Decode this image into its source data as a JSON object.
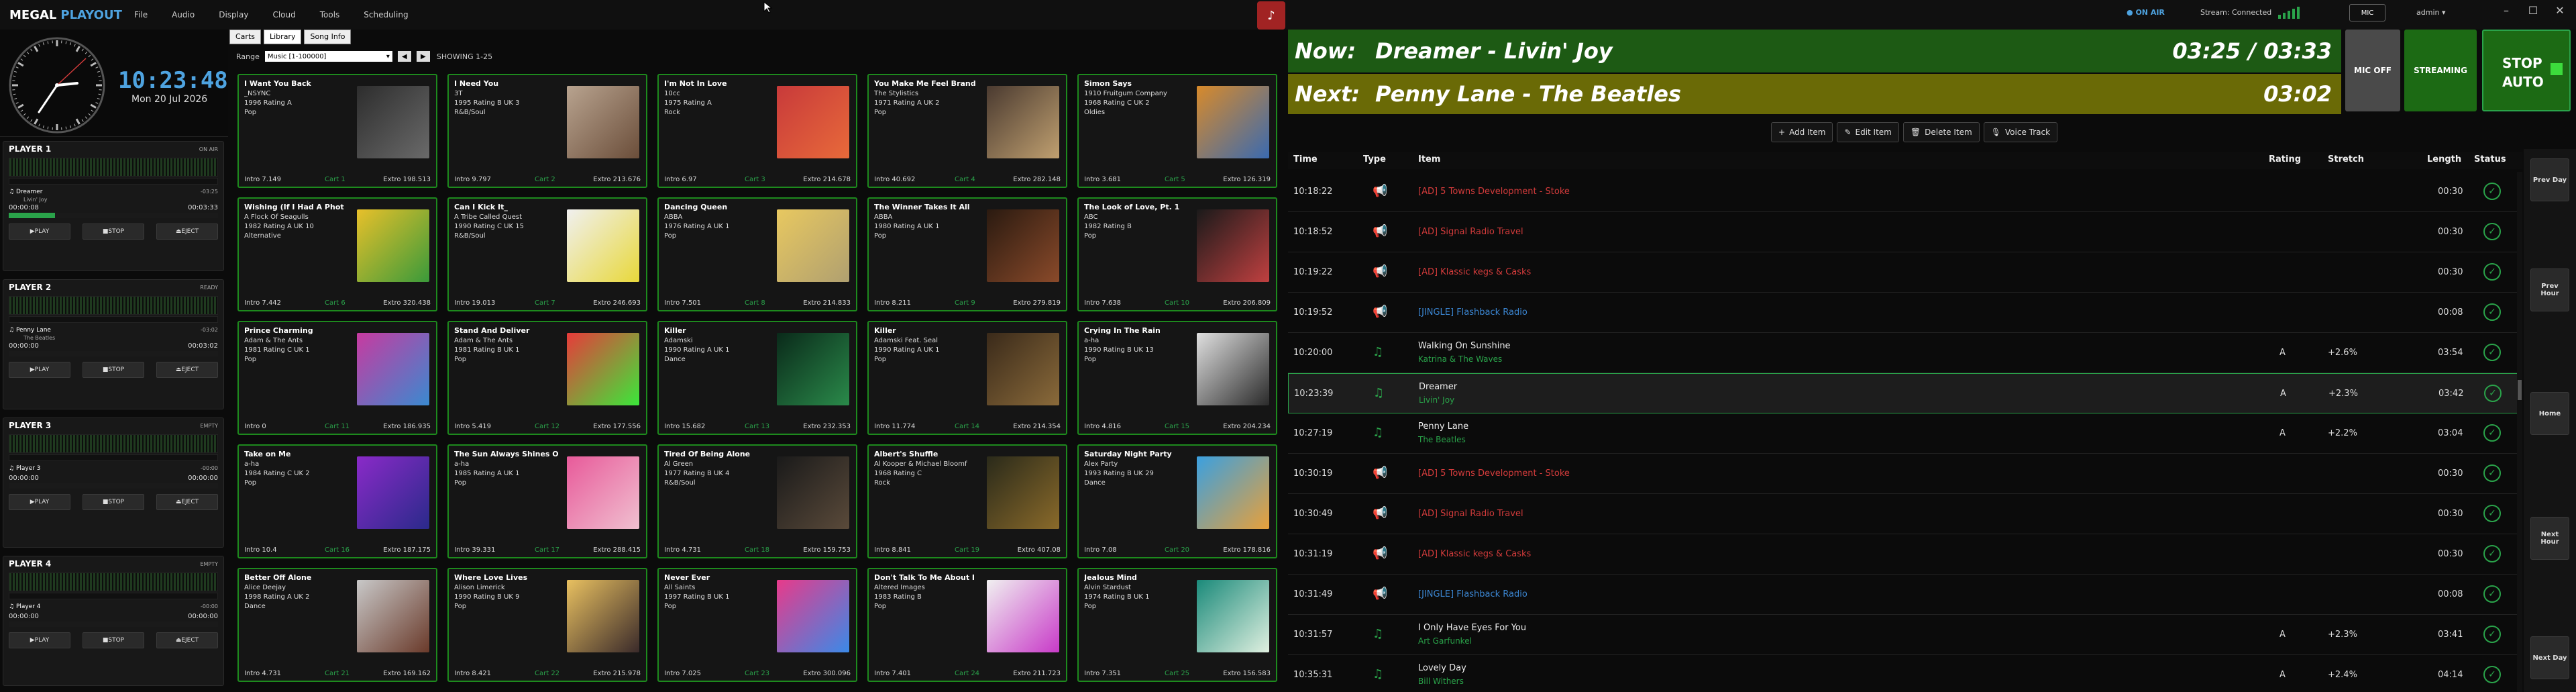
{
  "app": {
    "name1": "MEGAL",
    "name2": "PLAYOUT"
  },
  "menu": [
    "File",
    "Audio",
    "Display",
    "Cloud",
    "Tools",
    "Scheduling"
  ],
  "clock": {
    "time": "10:23:48",
    "date": "Mon 20 Jul 2026"
  },
  "players": [
    {
      "title": "PLAYER 1",
      "status": "ON AIR",
      "track": "Dreamer",
      "track_right": "-03:25",
      "artist": "Livin' Joy",
      "elapsed": "00:00:08",
      "remaining": "00:03:33",
      "progress": 0.22,
      "play": "PLAY",
      "stop": "STOP",
      "eject": "EJECT"
    },
    {
      "title": "PLAYER 2",
      "status": "READY",
      "track": "Penny Lane",
      "track_right": "-03:02",
      "artist": "The Beatles",
      "elapsed": "00:00:00",
      "remaining": "00:03:02",
      "progress": 0.0,
      "play": "PLAY",
      "stop": "STOP",
      "eject": "EJECT"
    },
    {
      "title": "PLAYER 3",
      "status": "EMPTY",
      "track": "Player 3",
      "track_right": "-00:00",
      "artist": "",
      "elapsed": "00:00:00",
      "remaining": "00:00:00",
      "progress": 0.0,
      "play": "PLAY",
      "stop": "STOP",
      "eject": "EJECT"
    },
    {
      "title": "PLAYER 4",
      "status": "EMPTY",
      "track": "Player 4",
      "track_right": "-00:00",
      "artist": "",
      "elapsed": "00:00:00",
      "remaining": "00:00:00",
      "progress": 0.0,
      "play": "PLAY",
      "stop": "STOP",
      "eject": "EJECT"
    }
  ],
  "library": {
    "tabs": [
      "Carts",
      "Library",
      "Song Info"
    ],
    "range_label": "Range",
    "range_value": "Music [1-100000]",
    "showing": "SHOWING 1-25",
    "cards": [
      {
        "title": "I Want You Back",
        "artist": "_NSYNC",
        "yearline": "1996  Rating A",
        "genre": "Pop",
        "intro": "Intro 7.149",
        "cart": "Cart 1",
        "extro": "Extro 198.513",
        "colors": [
          "#2d2d2d",
          "#6a6a6a"
        ]
      },
      {
        "title": "I Need You",
        "artist": "3T",
        "yearline": "1995  Rating B  UK 3",
        "genre": "R&B/Soul",
        "intro": "Intro 9.797",
        "cart": "Cart 2",
        "extro": "Extro 213.676",
        "colors": [
          "#b8a38f",
          "#6b4e3a"
        ]
      },
      {
        "title": "I'm Not In Love",
        "artist": "10cc",
        "yearline": "1975  Rating A",
        "genre": "Rock",
        "intro": "Intro 6.97",
        "cart": "Cart 3",
        "extro": "Extro 214.678",
        "colors": [
          "#c83a3a",
          "#e86a3a"
        ]
      },
      {
        "title": "You Make Me Feel Brand",
        "artist": "The Stylistics",
        "yearline": "1971  Rating A  UK 2",
        "genre": "Pop",
        "intro": "Intro 40.692",
        "cart": "Cart 4",
        "extro": "Extro 282.148",
        "colors": [
          "#4a3a30",
          "#c0a070"
        ]
      },
      {
        "title": "Simon Says",
        "artist": "1910 Fruitgum Company",
        "yearline": "1968  Rating C  UK 2",
        "genre": "Oldies",
        "intro": "Intro 3.681",
        "cart": "Cart 5",
        "extro": "Extro 126.319",
        "colors": [
          "#d88a2a",
          "#3a6ab0"
        ]
      },
      {
        "title": "Wishing (If I Had A Phot",
        "artist": "A Flock Of Seagulls",
        "yearline": "1982  Rating A  UK 10",
        "genre": "Alternative",
        "intro": "Intro 7.442",
        "cart": "Cart 6",
        "extro": "Extro 320.438",
        "colors": [
          "#e8c02a",
          "#3a9a3a"
        ]
      },
      {
        "title": "Can I Kick It_",
        "artist": "A Tribe Called Quest",
        "yearline": "1990  Rating C  UK 15",
        "genre": "R&B/Soul",
        "intro": "Intro 19.013",
        "cart": "Cart 7",
        "extro": "Extro 246.693",
        "colors": [
          "#f0f0f0",
          "#e8d83a"
        ]
      },
      {
        "title": "Dancing Queen",
        "artist": "ABBA",
        "yearline": "1976  Rating A  UK 1",
        "genre": "Pop",
        "intro": "Intro 7.501",
        "cart": "Cart 8",
        "extro": "Extro 214.833",
        "colors": [
          "#e8c860",
          "#b0a070"
        ]
      },
      {
        "title": "The Winner Takes It All",
        "artist": "ABBA",
        "yearline": "1980  Rating A  UK 1",
        "genre": "Pop",
        "intro": "Intro 8.211",
        "cart": "Cart 9",
        "extro": "Extro 279.819",
        "colors": [
          "#2a1a10",
          "#8a4a2a"
        ]
      },
      {
        "title": "The Look of Love, Pt. 1",
        "artist": "ABC",
        "yearline": "1982  Rating B",
        "genre": "Pop",
        "intro": "Intro 7.638",
        "cart": "Cart 10",
        "extro": "Extro 206.809",
        "colors": [
          "#1a1a1a",
          "#c04040"
        ]
      },
      {
        "title": "Prince Charming",
        "artist": "Adam & The Ants",
        "yearline": "1981  Rating C  UK 1",
        "genre": "Pop",
        "intro": "Intro 0",
        "cart": "Cart 11",
        "extro": "Extro 186.935",
        "colors": [
          "#c83aa0",
          "#3a8ad0"
        ]
      },
      {
        "title": "Stand And Deliver",
        "artist": "Adam & The Ants",
        "yearline": "1981  Rating B  UK 1",
        "genre": "Pop",
        "intro": "Intro 5.419",
        "cart": "Cart 12",
        "extro": "Extro 177.556",
        "colors": [
          "#e83a3a",
          "#3ae83a"
        ]
      },
      {
        "title": "Killer",
        "artist": "Adamski",
        "yearline": "1990  Rating A  UK 1",
        "genre": "Dance",
        "intro": "Intro 15.682",
        "cart": "Cart 13",
        "extro": "Extro 232.353",
        "colors": [
          "#0a2a1a",
          "#2a8a4a"
        ]
      },
      {
        "title": "Killer",
        "artist": "Adamski Feat. Seal",
        "yearline": "1990  Rating A  UK 1",
        "genre": "Pop",
        "intro": "Intro 11.774",
        "cart": "Cart 14",
        "extro": "Extro 214.354",
        "colors": [
          "#3a2a1a",
          "#8a6a3a"
        ]
      },
      {
        "title": "Crying In The Rain",
        "artist": "a-ha",
        "yearline": "1990  Rating B  UK 13",
        "genre": "Pop",
        "intro": "Intro 4.816",
        "cart": "Cart 15",
        "extro": "Extro 204.234",
        "colors": [
          "#e0e0e0",
          "#2a2a2a"
        ]
      },
      {
        "title": "Take on Me",
        "artist": "a-ha",
        "yearline": "1984  Rating C  UK 2",
        "genre": "Pop",
        "intro": "Intro 10.4",
        "cart": "Cart 16",
        "extro": "Extro 187.175",
        "colors": [
          "#8a2ac8",
          "#2a2a8a"
        ]
      },
      {
        "title": "The Sun Always Shines O",
        "artist": "a-ha",
        "yearline": "1985  Rating A  UK 1",
        "genre": "Pop",
        "intro": "Intro 39.331",
        "cart": "Cart 17",
        "extro": "Extro 288.415",
        "colors": [
          "#e85a9a",
          "#f0c0d0"
        ]
      },
      {
        "title": "Tired Of Being Alone",
        "artist": "Al Green",
        "yearline": "1977  Rating B  UK 4",
        "genre": "R&B/Soul",
        "intro": "Intro 4.731",
        "cart": "Cart 18",
        "extro": "Extro 159.753",
        "colors": [
          "#1a1a1a",
          "#5a4a3a"
        ]
      },
      {
        "title": "Albert's Shuffle",
        "artist": "Al Kooper & Michael Bloomf",
        "yearline": "1968  Rating C",
        "genre": "Rock",
        "intro": "Intro 8.841",
        "cart": "Cart 19",
        "extro": "Extro 407.08",
        "colors": [
          "#2a2a1a",
          "#8a6a2a"
        ]
      },
      {
        "title": "Saturday Night Party",
        "artist": "Alex Party",
        "yearline": "1993  Rating B  UK 29",
        "genre": "Dance",
        "intro": "Intro 7.08",
        "cart": "Cart 20",
        "extro": "Extro 178.816",
        "colors": [
          "#3aa0e0",
          "#e8a03a"
        ]
      },
      {
        "title": "Better Off Alone",
        "artist": "Alice Deejay",
        "yearline": "1998  Rating A  UK 2",
        "genre": "Dance",
        "intro": "Intro 4.731",
        "cart": "Cart 21",
        "extro": "Extro 169.162",
        "colors": [
          "#c8c8c8",
          "#6a3a2a"
        ]
      },
      {
        "title": "Where Love Lives",
        "artist": "Alison Limerick",
        "yearline": "1990  Rating B  UK 9",
        "genre": "Pop",
        "intro": "Intro 8.421",
        "cart": "Cart 22",
        "extro": "Extro 215.978",
        "colors": [
          "#e8c060",
          "#3a2a2a"
        ]
      },
      {
        "title": "Never Ever",
        "artist": "All Saints",
        "yearline": "1997  Rating B  UK 1",
        "genre": "Pop",
        "intro": "Intro 7.025",
        "cart": "Cart 23",
        "extro": "Extro 300.096",
        "colors": [
          "#e83a8a",
          "#3a8ae8"
        ]
      },
      {
        "title": "Don't Talk To Me About I",
        "artist": "Altered Images",
        "yearline": "1983  Rating B",
        "genre": "Pop",
        "intro": "Intro 7.401",
        "cart": "Cart 24",
        "extro": "Extro 211.723",
        "colors": [
          "#f0f0f0",
          "#c83ac8"
        ]
      },
      {
        "title": "Jealous Mind",
        "artist": "Alvin Stardust",
        "yearline": "1974  Rating B  UK 1",
        "genre": "Pop",
        "intro": "Intro 7.351",
        "cart": "Cart 25",
        "extro": "Extro 156.583",
        "colors": [
          "#1a8a7a",
          "#e0f0e0"
        ]
      }
    ]
  },
  "status": {
    "on_air": "ON AIR",
    "stream": "Stream: Connected",
    "mic": "MIC",
    "user": "admin"
  },
  "now": {
    "label": "Now:",
    "title": "Dreamer - Livin' Joy",
    "time": "03:25 / 03:33"
  },
  "next": {
    "label": "Next:",
    "title": "Penny Lane - The Beatles",
    "time": "03:02"
  },
  "buttons": {
    "mic_off": "MIC OFF",
    "streaming": "STREAMING",
    "stop_auto": "STOP AUTO"
  },
  "toolbar": {
    "add": "Add Item",
    "edit": "Edit Item",
    "delete": "Delete Item",
    "voice": "Voice Track"
  },
  "columns": {
    "time": "Time",
    "type": "Type",
    "item": "Item",
    "rating": "Rating",
    "stretch": "Stretch",
    "length": "Length",
    "status": "Status"
  },
  "playlist": [
    {
      "time": "10:18:22",
      "kind": "ad",
      "title": "[AD] 5 Towns Development - Stoke",
      "artist": "",
      "rating": "",
      "stretch": "",
      "length": "00:30"
    },
    {
      "time": "10:18:52",
      "kind": "ad",
      "title": "[AD] Signal Radio Travel",
      "artist": "",
      "rating": "",
      "stretch": "",
      "length": "00:30"
    },
    {
      "time": "10:19:22",
      "kind": "ad",
      "title": "[AD] Klassic kegs & Casks",
      "artist": "",
      "rating": "",
      "stretch": "",
      "length": "00:30"
    },
    {
      "time": "10:19:52",
      "kind": "jg",
      "title": "[JINGLE] Flashback Radio",
      "artist": "",
      "rating": "",
      "stretch": "",
      "length": "00:08"
    },
    {
      "time": "10:20:00",
      "kind": "sg",
      "title": "Walking On Sunshine",
      "artist": "Katrina & The Waves",
      "rating": "A",
      "stretch": "+2.6%",
      "length": "03:54"
    },
    {
      "time": "10:23:39",
      "kind": "sg",
      "title": "Dreamer",
      "artist": "Livin' Joy",
      "rating": "A",
      "stretch": "+2.3%",
      "length": "03:42"
    },
    {
      "time": "10:27:19",
      "kind": "sg",
      "title": "Penny Lane",
      "artist": "The Beatles",
      "rating": "A",
      "stretch": "+2.2%",
      "length": "03:04"
    },
    {
      "time": "10:30:19",
      "kind": "ad",
      "title": "[AD] 5 Towns Development - Stoke",
      "artist": "",
      "rating": "",
      "stretch": "",
      "length": "00:30"
    },
    {
      "time": "10:30:49",
      "kind": "ad",
      "title": "[AD] Signal Radio Travel",
      "artist": "",
      "rating": "",
      "stretch": "",
      "length": "00:30"
    },
    {
      "time": "10:31:19",
      "kind": "ad",
      "title": "[AD] Klassic kegs & Casks",
      "artist": "",
      "rating": "",
      "stretch": "",
      "length": "00:30"
    },
    {
      "time": "10:31:49",
      "kind": "jg",
      "title": "[JINGLE] Flashback Radio",
      "artist": "",
      "rating": "",
      "stretch": "",
      "length": "00:08"
    },
    {
      "time": "10:31:57",
      "kind": "sg",
      "title": "I Only Have Eyes For You",
      "artist": "Art Garfunkel",
      "rating": "A",
      "stretch": "+2.3%",
      "length": "03:41"
    },
    {
      "time": "10:35:31",
      "kind": "sg",
      "title": "Lovely Day",
      "artist": "Bill Withers",
      "rating": "A",
      "stretch": "+2.4%",
      "length": "04:14"
    }
  ],
  "sidenav": [
    "Prev Day",
    "Prev Hour",
    "Home",
    "Next Hour",
    "Next Day"
  ],
  "icons": {
    "ad": "megaphone-icon",
    "jingle": "megaphone-icon",
    "song": "music-note-icon",
    "status": "check-circle-icon"
  }
}
